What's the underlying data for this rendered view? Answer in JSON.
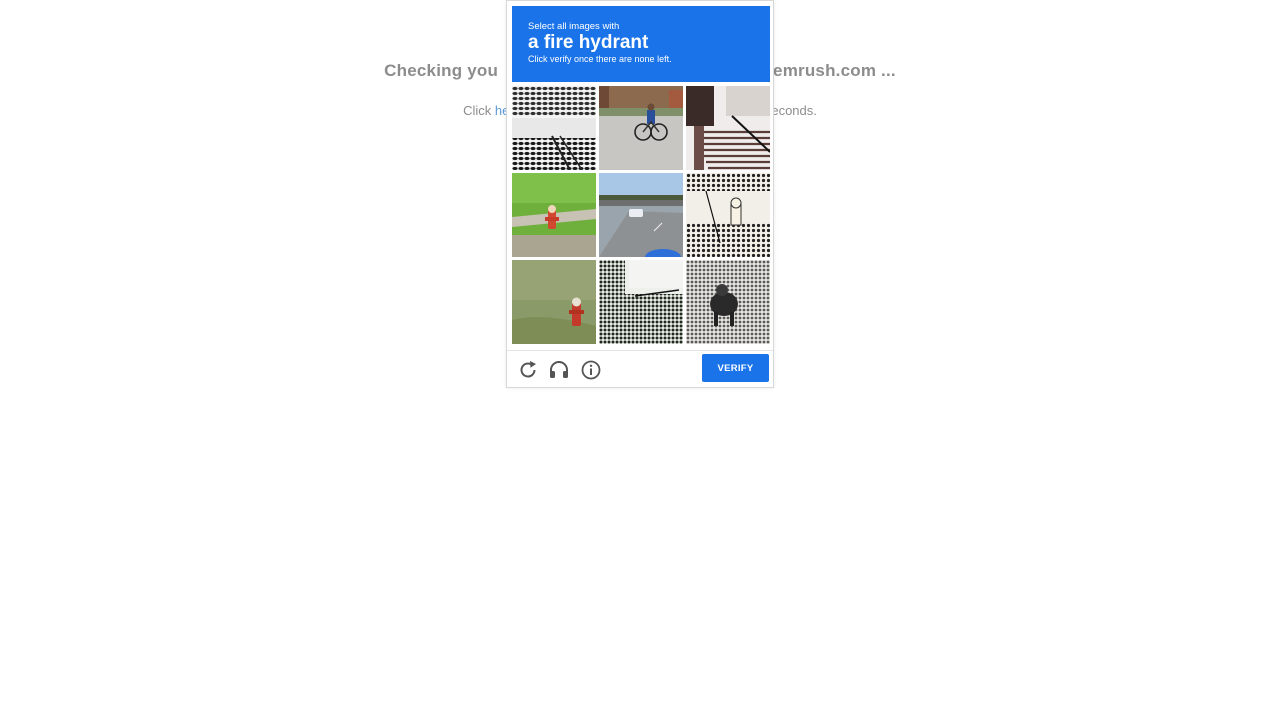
{
  "background": {
    "heading_left": "Checking you",
    "heading_right": "emrush.com ...",
    "sub_left": "Click ",
    "sub_link": "he",
    "sub_right": "econds."
  },
  "captcha": {
    "prompt_line1": "Select all images with",
    "prompt_target": "a fire hydrant",
    "prompt_line3": "Click verify once there are none left.",
    "tiles": [
      {
        "content": "halftone pattern"
      },
      {
        "content": "cyclist on street"
      },
      {
        "content": "stairs with railing"
      },
      {
        "content": "fire hydrant on grass"
      },
      {
        "content": "road with car"
      },
      {
        "content": "halftone hydrant"
      },
      {
        "content": "fire hydrant on grass"
      },
      {
        "content": "halftone building"
      },
      {
        "content": "halftone dog"
      }
    ],
    "verify_label": "VERIFY",
    "controls": {
      "reload": "reload-icon",
      "audio": "headphones-icon",
      "info": "info-icon"
    },
    "colors": {
      "accent": "#1a73e8"
    }
  }
}
